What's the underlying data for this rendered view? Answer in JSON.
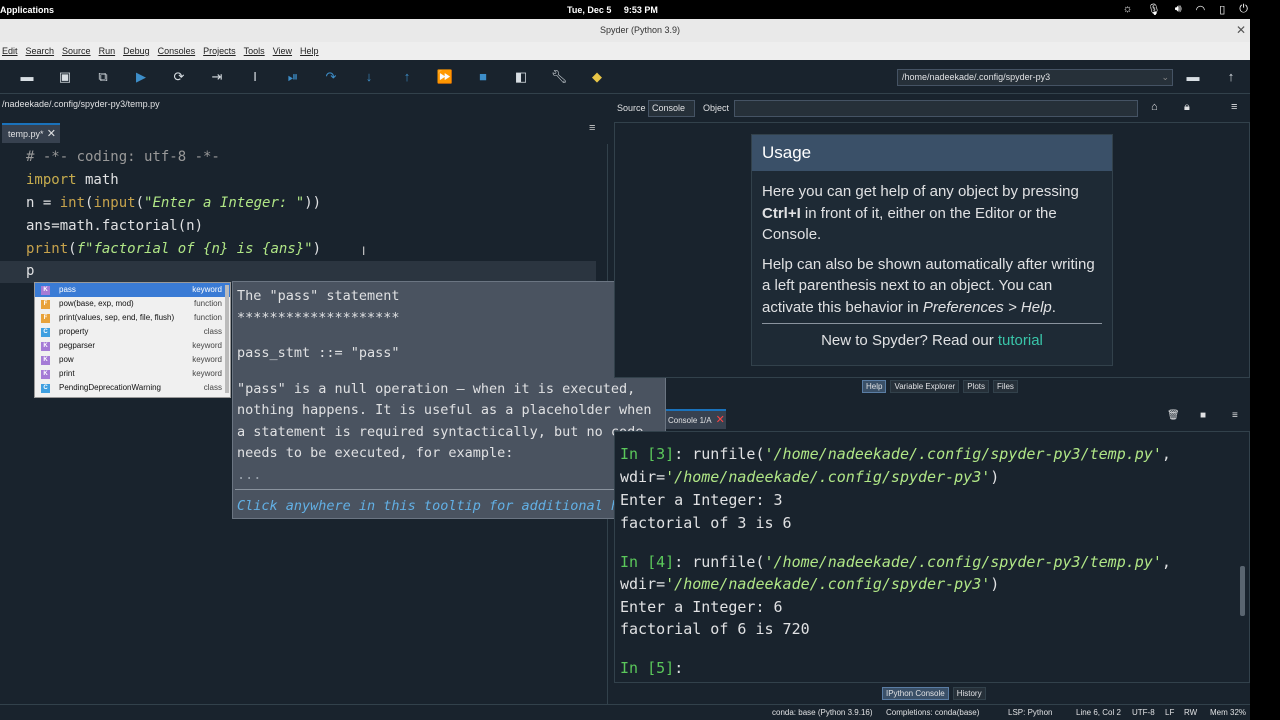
{
  "system_bar": {
    "apps_label": "Applications",
    "date": "Tue, Dec 5",
    "time": "9:53 PM"
  },
  "window": {
    "title": "Spyder (Python 3.9)"
  },
  "menu": [
    "Edit",
    "Search",
    "Source",
    "Run",
    "Debug",
    "Consoles",
    "Projects",
    "Tools",
    "View",
    "Help"
  ],
  "toolbar": {
    "icons": [
      "open-file-icon",
      "save-icon",
      "save-all-icon",
      "run-icon",
      "run-cell-icon",
      "run-cell-advance-icon",
      "run-selection-icon",
      "debug-icon",
      "step-icon",
      "step-into-icon",
      "step-return-icon",
      "continue-icon",
      "stop-icon",
      "maximize-pane-icon",
      "preferences-icon",
      "python-path-icon",
      "folder-browse-icon",
      "parent-dir-icon"
    ],
    "working_dir": "/home/nadeekade/.config/spyder-py3"
  },
  "editor": {
    "path": "/nadeekade/.config/spyder-py3/temp.py",
    "tab_label": "temp.py*",
    "current_input": "p"
  },
  "completion": {
    "items": [
      {
        "label": "pass",
        "kind": "keyword",
        "badge": "K",
        "selected": true
      },
      {
        "label": "pow(base, exp, mod)",
        "kind": "function",
        "badge": "F"
      },
      {
        "label": "print(values, sep, end, file, flush)",
        "kind": "function",
        "badge": "F"
      },
      {
        "label": "property",
        "kind": "class",
        "badge": "C"
      },
      {
        "label": "pegparser",
        "kind": "keyword",
        "badge": "K"
      },
      {
        "label": "pow",
        "kind": "keyword",
        "badge": "K"
      },
      {
        "label": "print",
        "kind": "keyword",
        "badge": "K"
      },
      {
        "label": "PendingDeprecationWarning",
        "kind": "class",
        "badge": "C"
      }
    ]
  },
  "tooltip": {
    "title": "The \"pass\" statement",
    "underline": "********************",
    "grammar": "pass_stmt ::= \"pass\"",
    "body": [
      "\"pass\" is a null operation — when it is executed,",
      "nothing happens. It is useful as a placeholder when",
      "a statement is required syntactically, but no code",
      "needs to be executed, for example:",
      "..."
    ],
    "help_link": "Click anywhere in this tooltip for additional help"
  },
  "help": {
    "source_label": "Source",
    "console_option": "Console",
    "object_label": "Object",
    "usage_title": "Usage",
    "p1_a": "Here you can get help of any object by pressing ",
    "p1_key": "Ctrl+I",
    "p1_b": " in front of it, either on the Editor or the Console.",
    "p2_a": "Help can also be shown automatically after writing a left parenthesis next to an object. You can activate this behavior in ",
    "p2_pref": "Preferences > Help",
    "p2_b": ".",
    "new_text": "New to Spyder? Read our ",
    "tutorial_link": "tutorial",
    "tabs": [
      "Help",
      "Variable Explorer",
      "Plots",
      "Files"
    ]
  },
  "console": {
    "tab_label": "Console 1/A",
    "tabs": [
      "IPython Console",
      "History"
    ]
  },
  "status": {
    "env": "conda: base (Python 3.9.16)",
    "completions": "Completions: conda(base)",
    "lsp": "LSP: Python",
    "position": "Line 6, Col 2",
    "encoding": "UTF-8",
    "eol": "LF",
    "mode": "RW",
    "memory": "Mem 32%"
  }
}
